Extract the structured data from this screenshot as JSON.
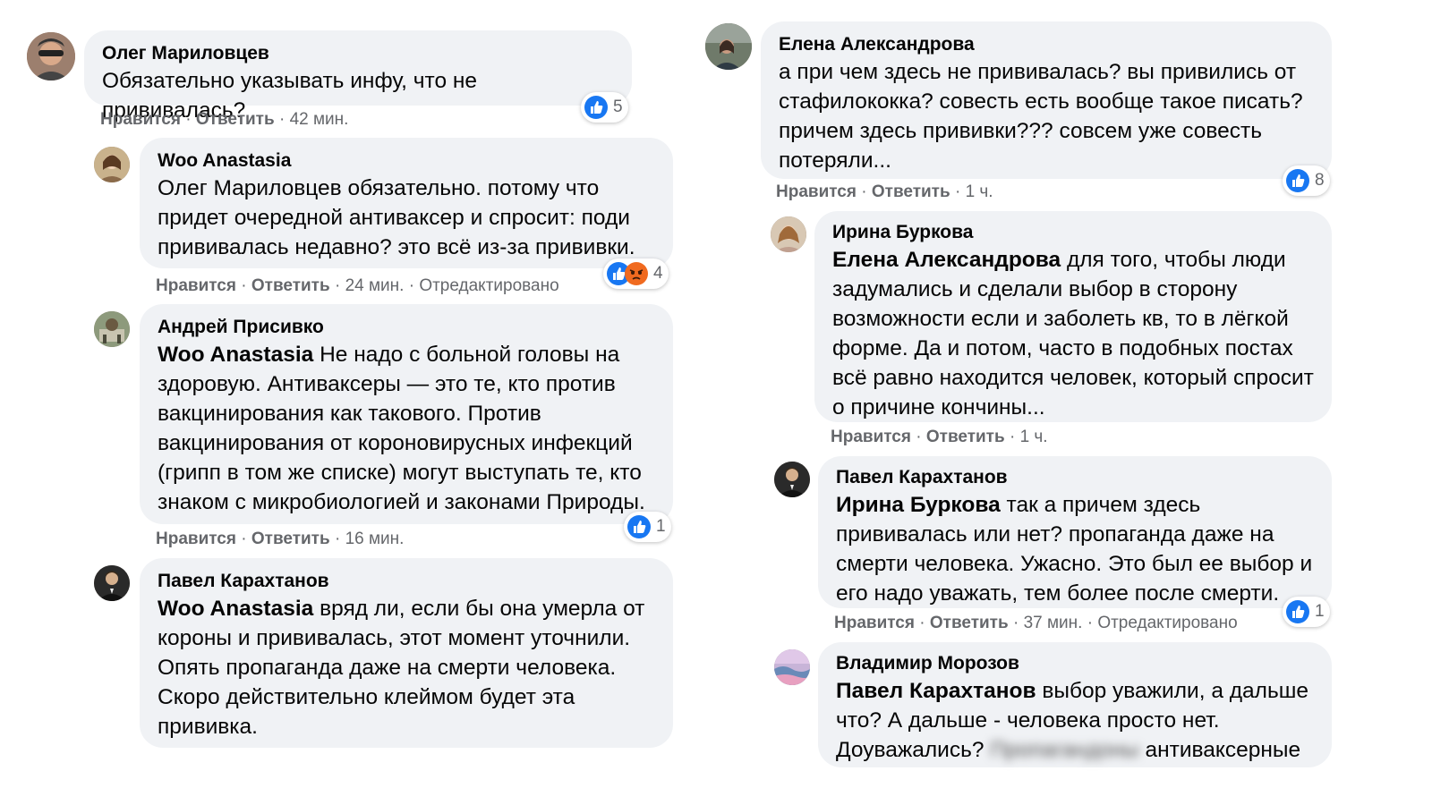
{
  "left_column": [
    {
      "author": "Олег Мариловцев",
      "text": "Обязательно указывать инфу, что не прививалась?",
      "actions": {
        "like": "Нравится",
        "reply": "Ответить",
        "time": "42 мин."
      },
      "reactions": {
        "count": "5",
        "types": [
          "like"
        ]
      }
    },
    {
      "author": "Woo Anastasia",
      "text": "Олег Мариловцев обязательно. потому что придет очередной антиваксер и спросит: поди прививалась недавно? это всё из-за прививки.",
      "actions": {
        "like": "Нравится",
        "reply": "Ответить",
        "time": "24 мин.",
        "edited": "Отредактировано"
      },
      "reactions": {
        "count": "4",
        "types": [
          "like",
          "angry"
        ]
      }
    },
    {
      "author": "Андрей Присивко",
      "mention": "Woo Anastasia",
      "text": " Не надо с больной головы на здоровую. Антиваксеры — это те, кто против вакцинирования как такового. Против вакцинирования от короновирусных инфекций (грипп в том же списке) могут выступать те, кто знаком с микробиологией и законами Природы.",
      "actions": {
        "like": "Нравится",
        "reply": "Ответить",
        "time": "16 мин."
      },
      "reactions": {
        "count": "1",
        "types": [
          "like"
        ]
      }
    },
    {
      "author": "Павел Карахтанов",
      "mention": "Woo Anastasia",
      "text": " вряд ли, если бы она умерла от короны и прививалась, этот момент уточнили. Опять пропаганда даже на смерти человека. Скоро действительно клеймом будет эта прививка."
    }
  ],
  "right_column": [
    {
      "author": "Елена Александрова",
      "text": "а при чем здесь не прививалась? вы привились от стафилококка? совесть есть вообще такое писать? причем здесь прививки??? совсем уже совесть потеряли...",
      "actions": {
        "like": "Нравится",
        "reply": "Ответить",
        "time": "1 ч."
      },
      "reactions": {
        "count": "8",
        "types": [
          "like"
        ]
      }
    },
    {
      "author": "Ирина Буркова",
      "mention": "Елена Александрова",
      "text": " для того, чтобы люди задумались и сделали выбор в сторону возможности если и заболеть кв, то в лёгкой форме. Да и потом, часто в подобных постах всё равно находится человек, который спросит о причине кончины...",
      "actions": {
        "like": "Нравится",
        "reply": "Ответить",
        "time": "1 ч."
      }
    },
    {
      "author": "Павел Карахтанов",
      "mention": "Ирина Буркова",
      "text": " так а причем здесь прививалась или нет? пропаганда даже на смерти человека. Ужасно. Это был ее выбор и его надо уважать, тем более после смерти.",
      "actions": {
        "like": "Нравится",
        "reply": "Ответить",
        "time": "37 мин.",
        "edited": "Отредактировано"
      },
      "reactions": {
        "count": "1",
        "types": [
          "like"
        ]
      }
    },
    {
      "author": "Владимир Морозов",
      "mention": "Павел Карахтанов",
      "text": " выбор уважили, а дальше что? А дальше - человека просто нет. Доуважались? ",
      "blurred_text": "Пропагандоны",
      "text_tail": " антиваксерные"
    }
  ],
  "colors": {
    "bubble": "#f0f2f5",
    "meta": "#65676b",
    "like": "#1877f2",
    "angry": "#f06a1f"
  }
}
